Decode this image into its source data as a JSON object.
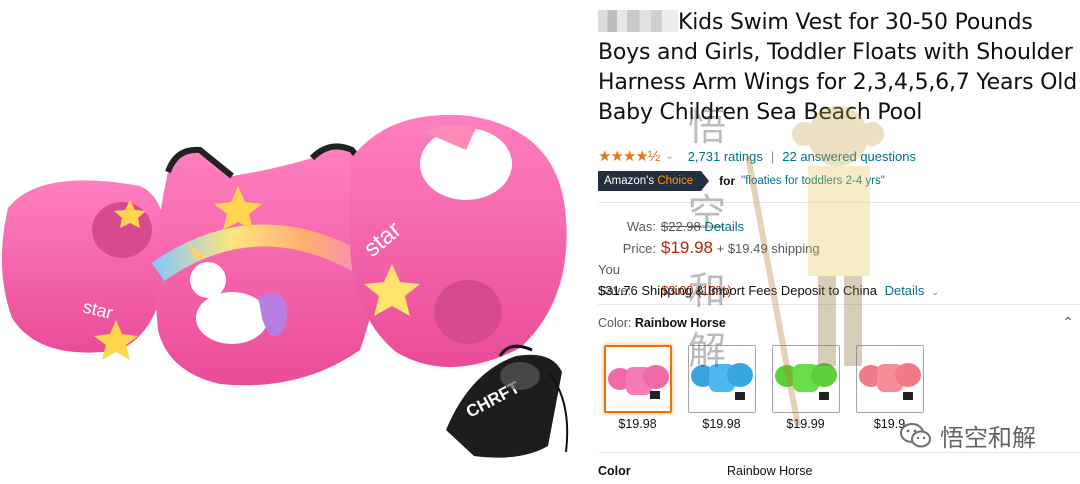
{
  "product": {
    "title_rest": "Kids Swim Vest for 30-50 Pounds Boys and Girls, Toddler Floats with Shoulder Harness Arm Wings for 2,3,4,5,6,7 Years Old Baby Children Sea Beach Pool",
    "rating_stars": "★★★★½",
    "ratings_text": "2,731 ratings",
    "separator": "|",
    "answered_text": "22 answered questions",
    "image_bag_text": "CHRFT",
    "image_star_text": "star"
  },
  "badge": {
    "prefix": "Amazon's",
    "accent": "Choice",
    "for_label": "for",
    "query": "\"floaties for toddlers 2-4 yrs\""
  },
  "pricing": {
    "was_label": "Was:",
    "was_value": "$22.98",
    "details_label": "Details",
    "price_label": "Price:",
    "price_value": "$19.98",
    "shipping": "+ $19.49 shipping",
    "save_label": "You Save:",
    "save_value": "$3.00 (13%)",
    "import_text": "$31.76 Shipping & Import Fees Deposit to China",
    "import_details": "Details"
  },
  "color": {
    "label": "Color:",
    "selected": "Rainbow Horse",
    "swatches": [
      {
        "price": "$19.98",
        "tone": "#f06aa8"
      },
      {
        "price": "$19.98",
        "tone": "#37a6e0"
      },
      {
        "price": "$19.99",
        "tone": "#5ccf3a"
      },
      {
        "price": "$19.9",
        "tone": "#f07a86"
      }
    ]
  },
  "spec": {
    "label": "Color",
    "value": "Rainbow Horse"
  },
  "watermark": {
    "chars": [
      "悟",
      "空",
      "和",
      "解"
    ],
    "wechat_text": "悟空和解"
  },
  "colors": {
    "link": "#007185",
    "price": "#b12704",
    "star": "#de7921",
    "badge_bg": "#232f3e",
    "badge_accent": "#ff9900",
    "selected_border": "#e77600",
    "vest_pink": "#f25fa3"
  }
}
